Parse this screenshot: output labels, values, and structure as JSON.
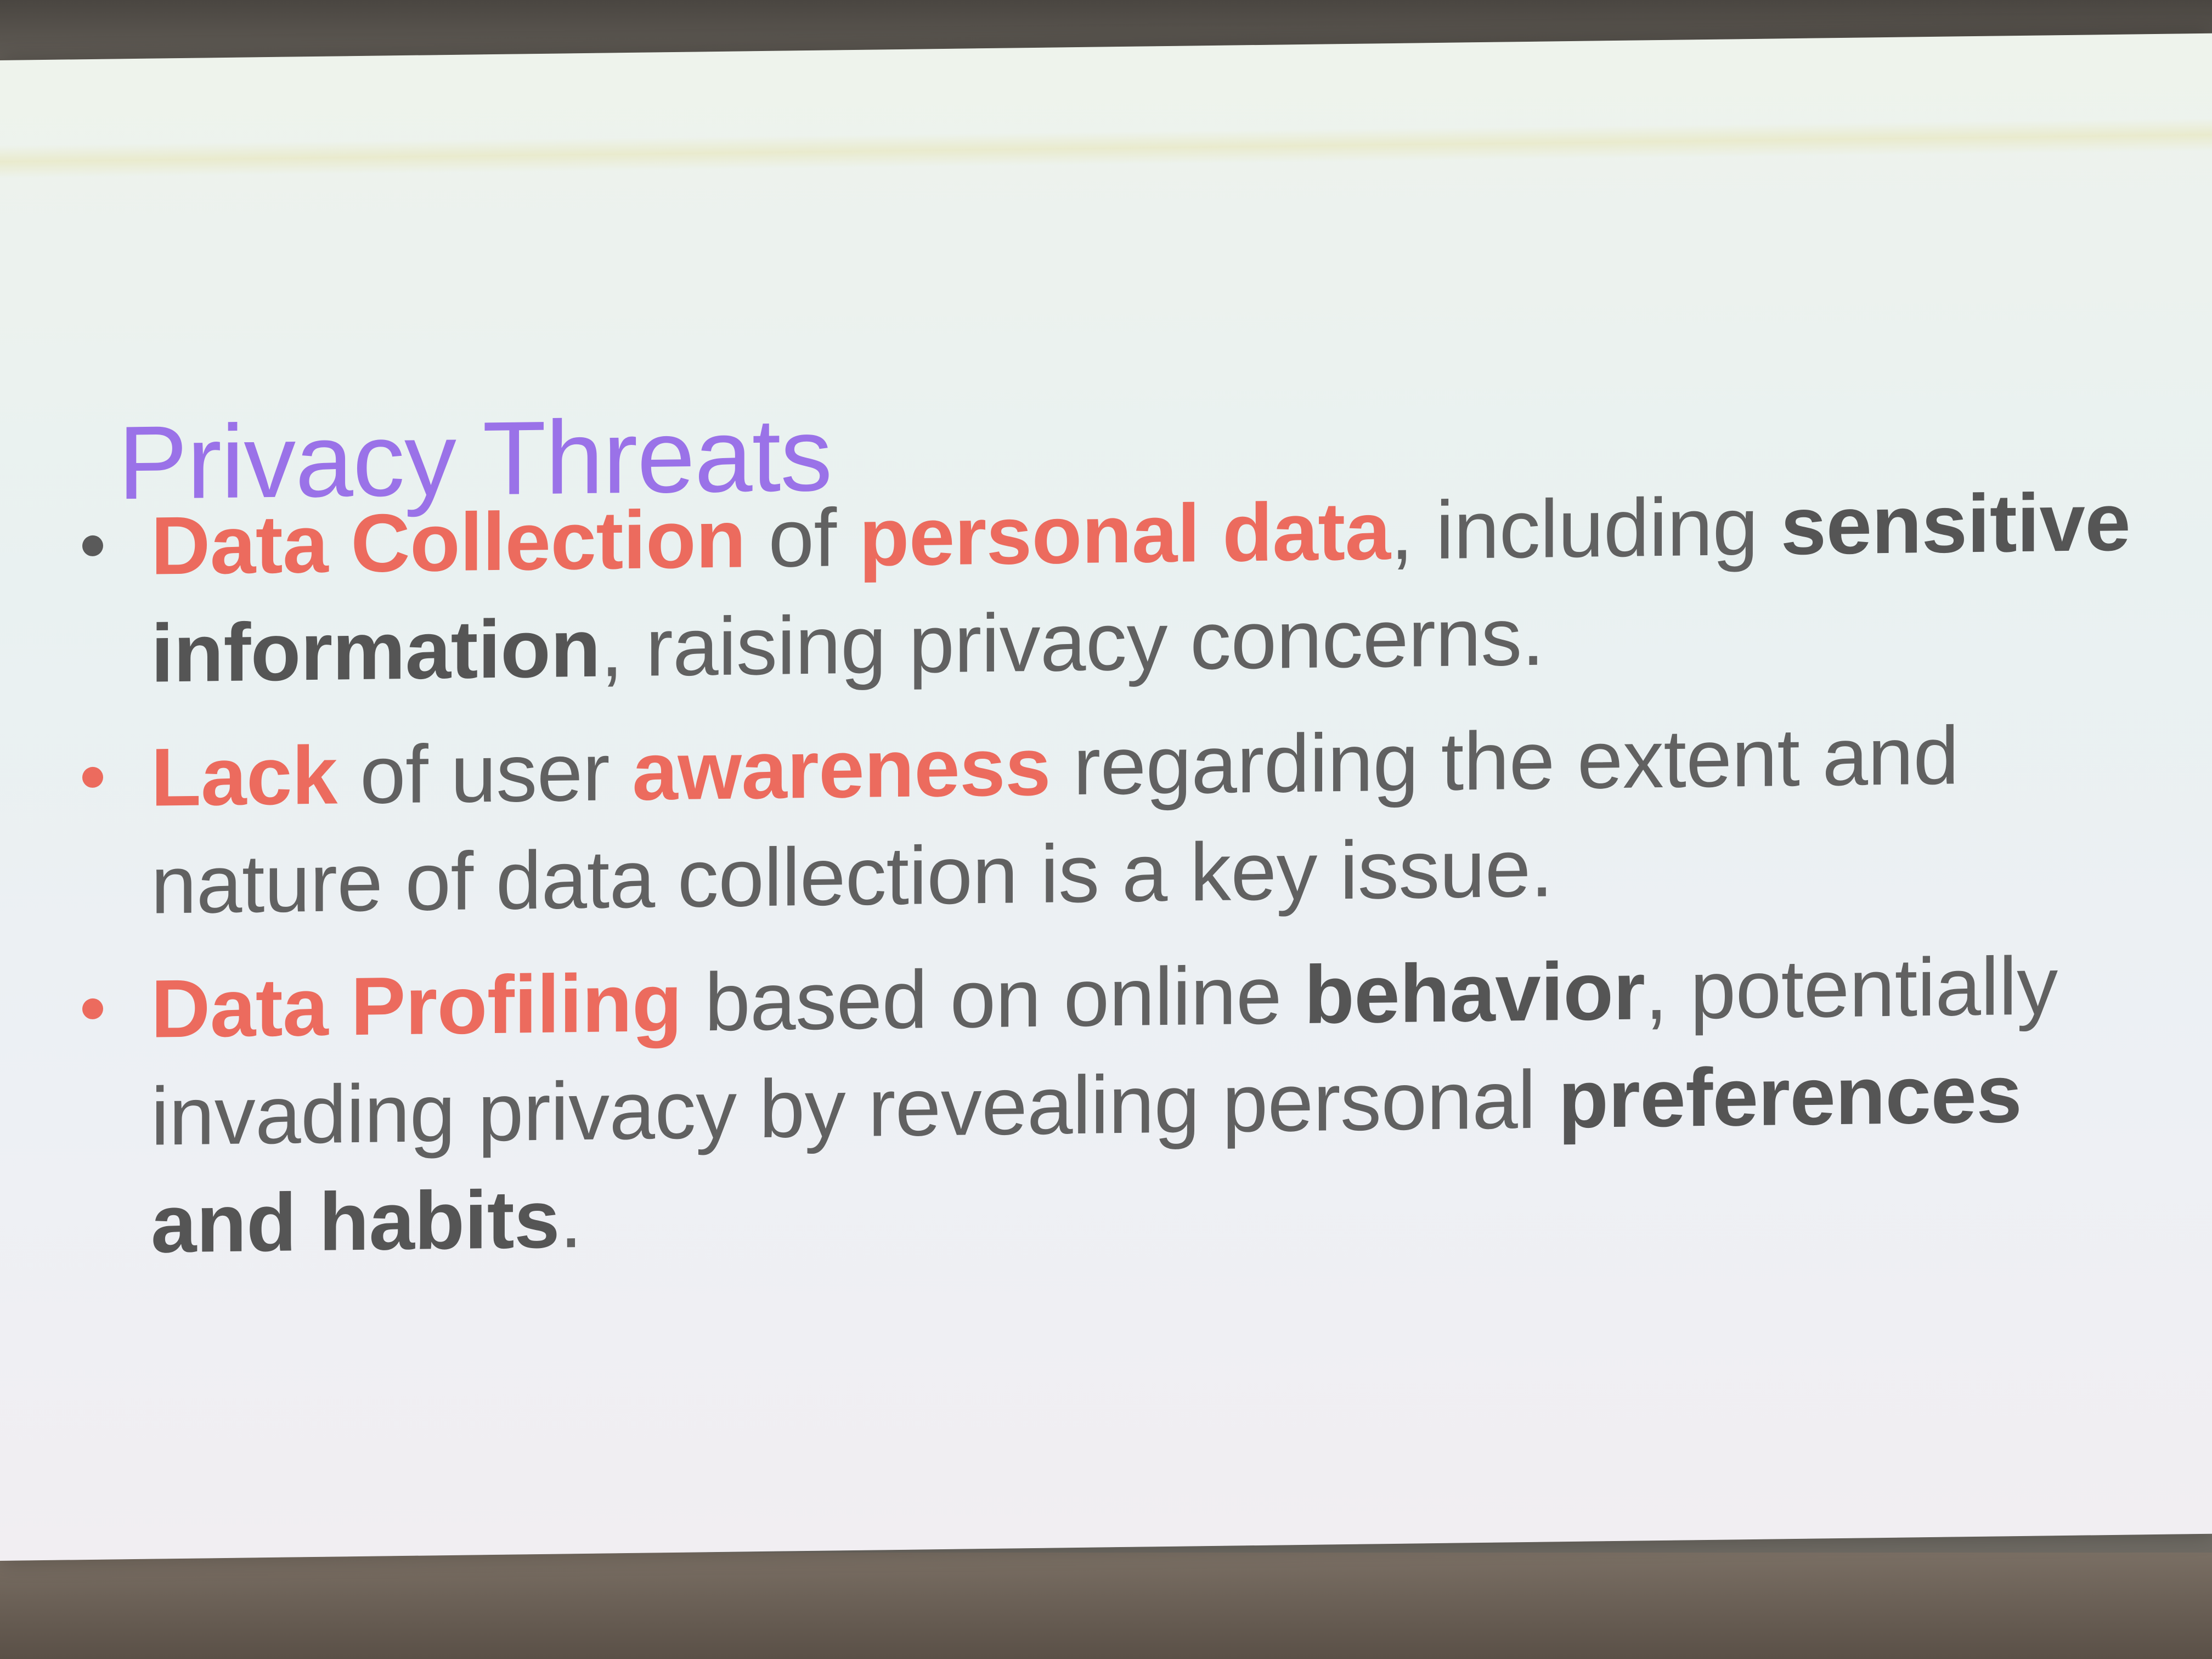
{
  "slide": {
    "title": "Privacy Threats",
    "colors": {
      "title": "#9a72e8",
      "highlight": "#ec6b5e",
      "body": "#616161",
      "emphasis": "#555555",
      "first_bullet": "#5a5a5a"
    },
    "bullets": [
      {
        "segments": [
          {
            "text": "Data Collection",
            "style": "highlight"
          },
          {
            "text": " of ",
            "style": "normal"
          },
          {
            "text": "personal data",
            "style": "highlight"
          },
          {
            "text": ", including ",
            "style": "normal"
          },
          {
            "text": "sensitive information",
            "style": "emphasis"
          },
          {
            "text": ", raising privacy concerns.",
            "style": "normal"
          }
        ]
      },
      {
        "segments": [
          {
            "text": "Lack",
            "style": "highlight"
          },
          {
            "text": " of user ",
            "style": "normal"
          },
          {
            "text": "awareness",
            "style": "highlight"
          },
          {
            "text": " regarding the extent and nature of data collection is a key issue.",
            "style": "normal"
          }
        ]
      },
      {
        "segments": [
          {
            "text": "Data Profiling",
            "style": "highlight"
          },
          {
            "text": " based on online ",
            "style": "normal"
          },
          {
            "text": "behavior",
            "style": "emphasis"
          },
          {
            "text": ", potentially invading privacy by revealing personal ",
            "style": "normal"
          },
          {
            "text": "preferences and habits",
            "style": "emphasis"
          },
          {
            "text": ".",
            "style": "normal"
          }
        ]
      }
    ]
  }
}
